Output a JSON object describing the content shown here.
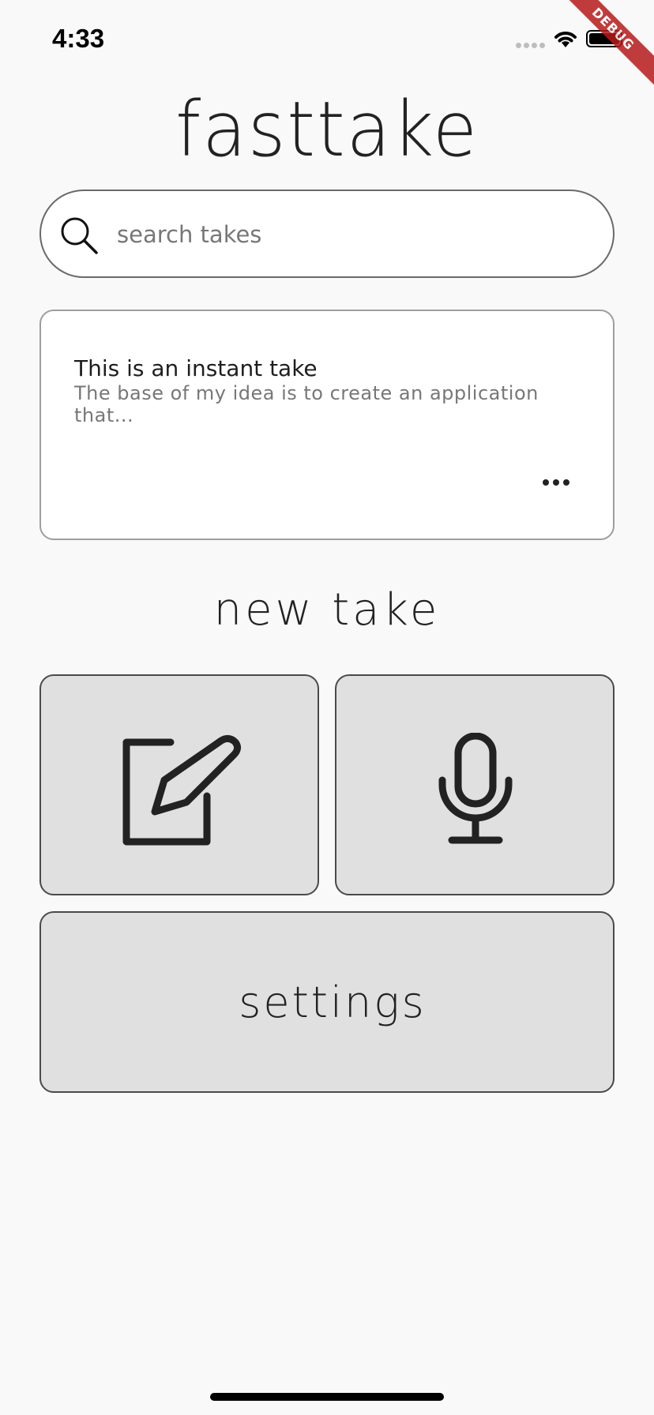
{
  "status_bar": {
    "time": "4:33"
  },
  "debug_banner": {
    "label": "DEBUG"
  },
  "app": {
    "title": "fasttake"
  },
  "search": {
    "placeholder": "search takes",
    "value": ""
  },
  "takes": [
    {
      "title": "This is an instant take",
      "preview": "The base of my idea is to create an application that..."
    }
  ],
  "new_take": {
    "title": "new take",
    "actions": [
      {
        "icon": "edit-icon"
      },
      {
        "icon": "microphone-icon"
      }
    ]
  },
  "settings": {
    "label": "settings"
  },
  "colors": {
    "background": "#f9f9f9",
    "tile": "#e0e0e0",
    "debug_ribbon": "#b71c1c"
  }
}
